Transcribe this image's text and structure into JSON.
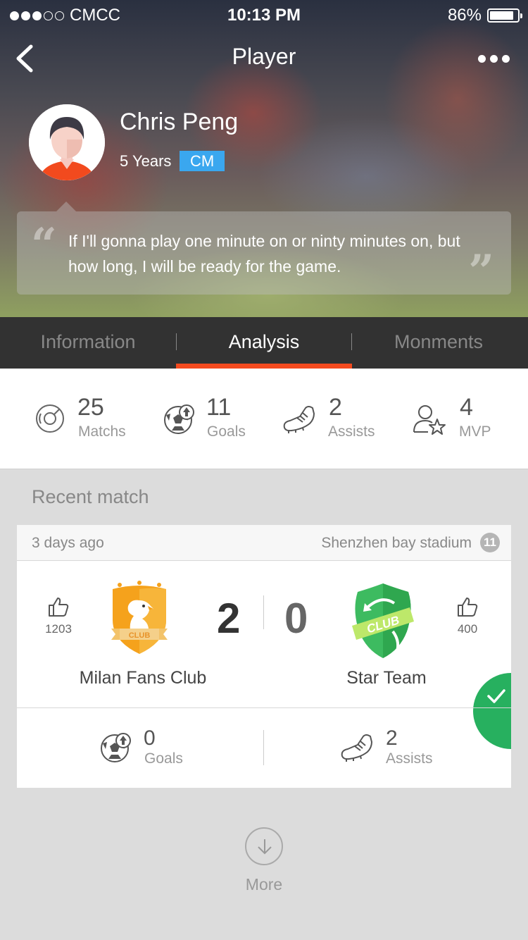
{
  "status_bar": {
    "carrier": "CMCC",
    "time": "10:13 PM",
    "battery": "86%",
    "battery_level": 0.86,
    "signal_bars": 3
  },
  "nav": {
    "title": "Player",
    "back_icon": "chevron-left-icon",
    "more_icon": "more-dots-icon"
  },
  "player": {
    "name": "Chris Peng",
    "experience": "5 Years",
    "position": "CM",
    "quote": "If I'll gonna play one minute  on or ninty minutes on, but how long, I will be ready for the game."
  },
  "tabs": [
    {
      "label": "Information",
      "active": false
    },
    {
      "label": "Analysis",
      "active": true
    },
    {
      "label": "Monments",
      "active": false
    }
  ],
  "stats": [
    {
      "value": "25",
      "label": "Matchs",
      "icon": "record-icon"
    },
    {
      "value": "11",
      "label": "Goals",
      "icon": "soccer-ball-icon"
    },
    {
      "value": "2",
      "label": "Assists",
      "icon": "boot-icon"
    },
    {
      "value": "4",
      "label": "MVP",
      "icon": "user-star-icon"
    }
  ],
  "recent": {
    "title": "Recent match",
    "time_ago": "3 days ago",
    "venue": "Shenzhen bay stadium",
    "venue_badge": "11",
    "home": {
      "name": "Milan Fans Club",
      "score": "2",
      "likes": "1203",
      "badge_text": "CLUB",
      "color": "#f5a21c"
    },
    "away": {
      "name": "Star Team",
      "score": "0",
      "likes": "400",
      "badge_text": "CLUB",
      "color": "#3dbb60"
    },
    "player_stats": [
      {
        "value": "0",
        "label": "Goals",
        "icon": "soccer-ball-icon"
      },
      {
        "value": "2",
        "label": "Assists",
        "icon": "boot-icon"
      }
    ]
  },
  "more_label": "More",
  "colors": {
    "accent": "#f44a1e",
    "badge": "#3aa7ef",
    "win": "#27b05f",
    "tab_bg": "#323232"
  }
}
